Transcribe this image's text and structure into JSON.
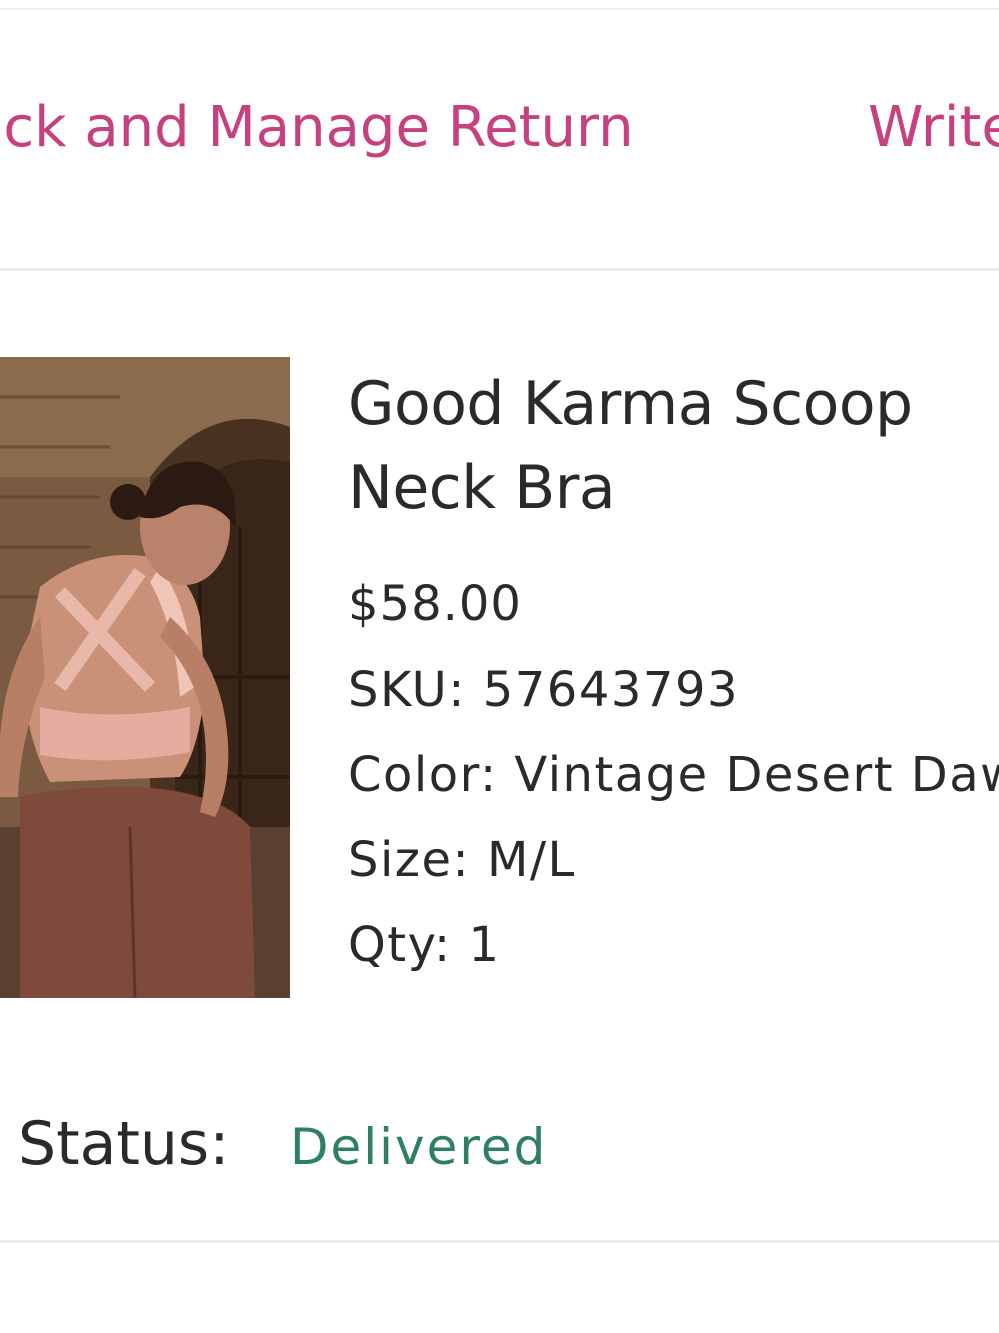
{
  "actions": {
    "track_return": "Track and Manage Return",
    "write_review": "Write a Review"
  },
  "product": {
    "name": "Good Karma Scoop Neck Bra",
    "price": "$58.00",
    "sku": "SKU: 57643793",
    "color": "Color: Vintage Desert Dawn",
    "size": "Size: M/L",
    "qty": "Qty: 1"
  },
  "status": {
    "label": "Status:",
    "value": "Delivered"
  },
  "colors": {
    "link": "#c7407f",
    "status_delivered": "#2e7f66",
    "text": "#2a2a2a",
    "divider": "#ececec"
  }
}
